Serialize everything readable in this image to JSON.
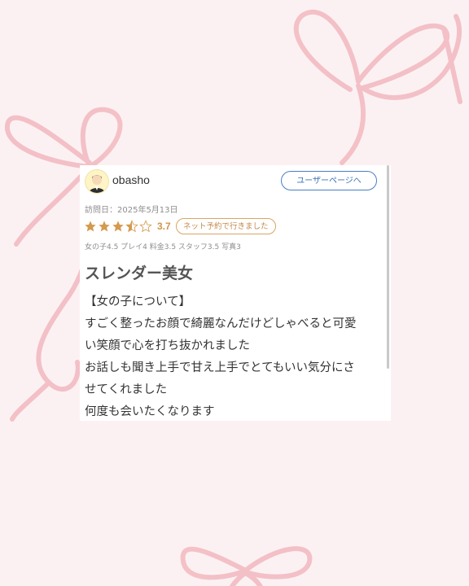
{
  "review": {
    "username": "obasho",
    "user_page_label": "ユーザーページへ",
    "visit_date": "訪問日：2025年5月13日",
    "rating": {
      "value": "3.7",
      "stars_filled": 3.5,
      "stars_total": 5,
      "star_color": "#d49a4e"
    },
    "badge": "ネット予約で行きました",
    "sub_scores": "女の子4.5 プレイ4 料金3.5 スタッフ3.5 写真3",
    "title": "スレンダー美女",
    "body_lines": [
      "【女の子について】",
      "すごく整ったお顔で綺麗なんだけどしゃべると可愛",
      "い笑顔で心を打ち抜かれました",
      "お話しも聞き上手で甘え上手でとてもいい気分にさ",
      "せてくれました",
      "何度も会いたくなります"
    ]
  },
  "icons": {
    "avatar": "user-avatar-icon",
    "star": "star-icon",
    "decoration": "pink-ribbon-bow"
  },
  "colors": {
    "background": "#fcf1f2",
    "ribbon": "#f2b8c0",
    "button_border": "#4a7ec6",
    "badge_border": "#d9a564"
  }
}
